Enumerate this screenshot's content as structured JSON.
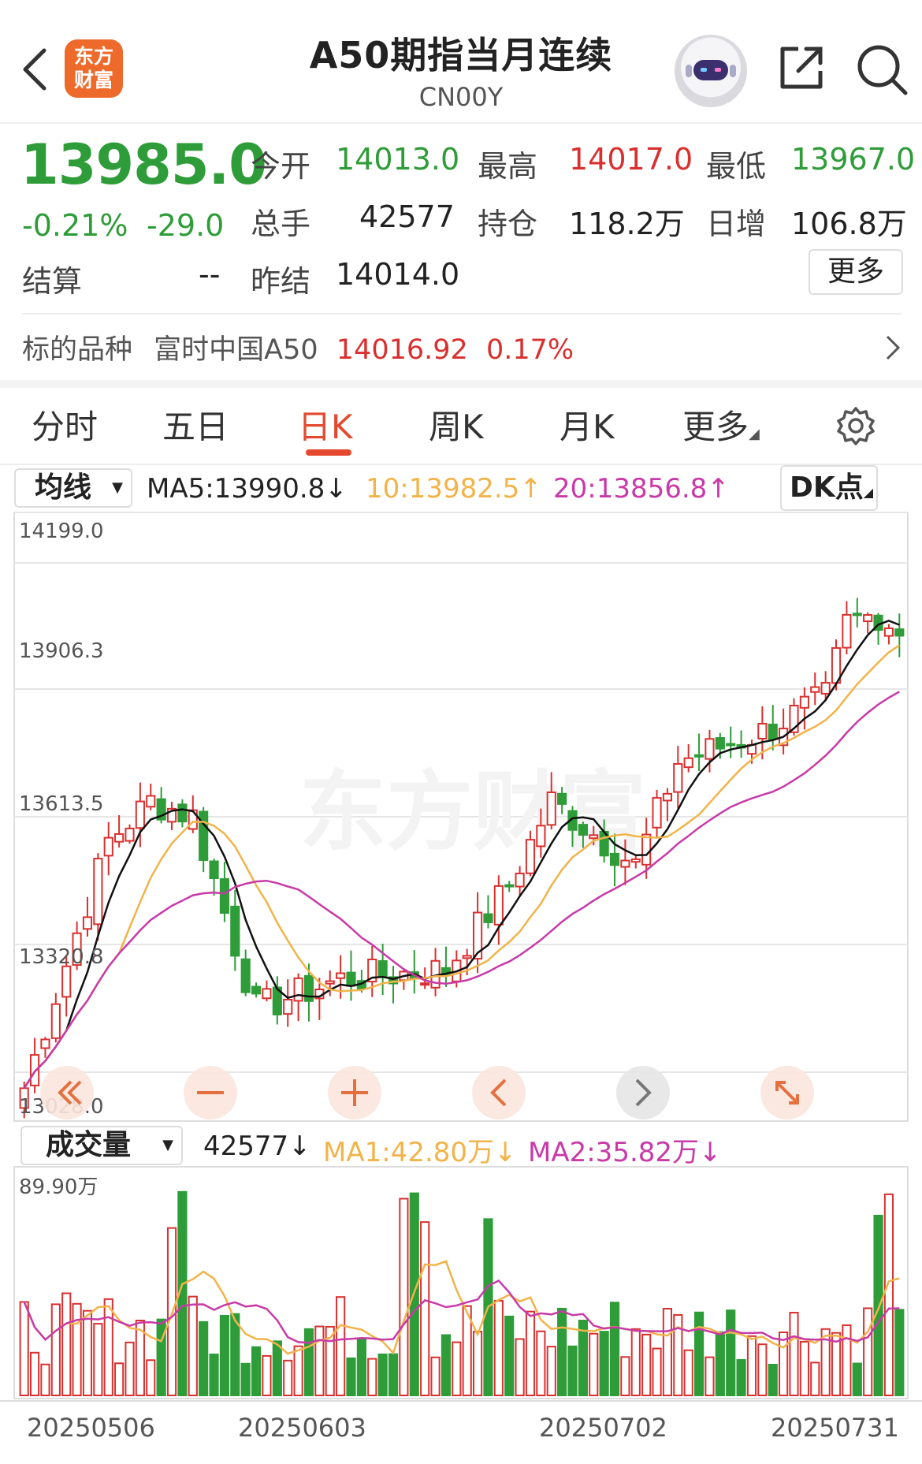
{
  "header": {
    "title": "A50期指当月连续",
    "code": "CN00Y",
    "logo_line1": "东方",
    "logo_line2": "财富"
  },
  "quote": {
    "price": "13985.0",
    "change_pct": "-0.21%",
    "change": "-29.0",
    "open_label": "今开",
    "open": "14013.0",
    "high_label": "最高",
    "high": "14017.0",
    "low_label": "最低",
    "low": "13967.0",
    "volume_label": "总手",
    "volume": "42577",
    "oi_label": "持仓",
    "oi": "118.2万",
    "daily_inc_label": "日增",
    "daily_inc": "106.8万",
    "settle_label": "结算",
    "settle": "--",
    "prev_settle_label": "昨结",
    "prev_settle": "14014.0",
    "more_button": "更多"
  },
  "underlying": {
    "label": "标的品种",
    "name": "富时中国A50",
    "value": "14016.92",
    "pct": "0.17%"
  },
  "tabs": [
    {
      "label": "分时"
    },
    {
      "label": "五日"
    },
    {
      "label": "日K"
    },
    {
      "label": "周K"
    },
    {
      "label": "月K"
    },
    {
      "label": "更多"
    }
  ],
  "indicators": {
    "selector": "均线",
    "ma5": "MA5:13990.8↓",
    "ma10": "10:13982.5↑",
    "ma20": "20:13856.8↑",
    "dk_button": "DK点",
    "vol_selector": "成交量",
    "vol": "42577↓",
    "vol_ma1": "MA1:42.80万↓",
    "vol_ma2": "MA2:35.82万↓"
  },
  "colors": {
    "up": "#d9302f",
    "down": "#2e9c38",
    "ma5": "#111111",
    "ma10": "#f2b34a",
    "ma20": "#c83aa8",
    "accent": "#e4492f"
  },
  "chart_data": {
    "type": "candlestick",
    "price_axis_labels": [
      "14199.0",
      "13906.3",
      "13613.5",
      "13320.8",
      "13028.0"
    ],
    "volume_axis_label": "89.90万",
    "date_labels": [
      "20250506",
      "20250603",
      "20250702",
      "20250731"
    ],
    "watermark": "东方财富"
  }
}
